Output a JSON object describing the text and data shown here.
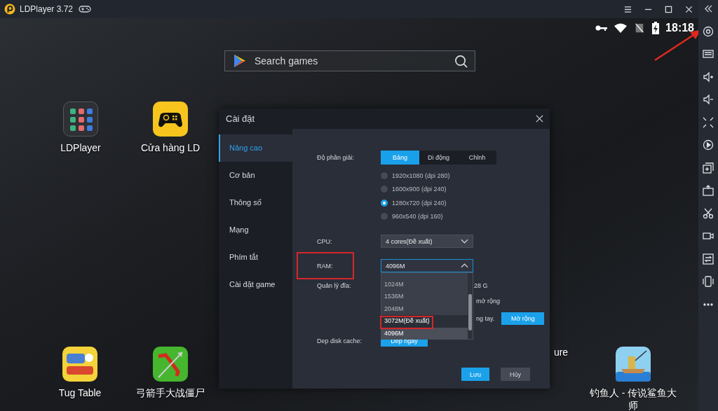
{
  "window": {
    "title": "LDPlayer 3.72"
  },
  "status_bar": {
    "time": "18:18"
  },
  "search": {
    "placeholder": "Search games"
  },
  "desktop_apps": [
    {
      "label": "LDPlayer",
      "kind": "folder"
    },
    {
      "label": "Cửa hàng LD",
      "kind": "store"
    },
    {
      "label": "Tug Table",
      "kind": "tug"
    },
    {
      "label": "弓箭手大战僵尸",
      "kind": "archer"
    },
    {
      "label": "ure",
      "kind": "partial"
    },
    {
      "label": "钓鱼人 - 传说鲨鱼大师",
      "kind": "fisher"
    }
  ],
  "dialog": {
    "title": "Cài đặt",
    "nav": [
      {
        "label": "Nâng cao",
        "selected": true
      },
      {
        "label": "Cơ bản",
        "selected": false
      },
      {
        "label": "Thông số",
        "selected": false
      },
      {
        "label": "Mạng",
        "selected": false
      },
      {
        "label": "Phím tắt",
        "selected": false
      },
      {
        "label": "Cài đặt game",
        "selected": false
      }
    ],
    "resolution": {
      "label": "Độ phân giải:",
      "tabs": [
        {
          "label": "Bảng",
          "selected": true
        },
        {
          "label": "Di động",
          "selected": false
        },
        {
          "label": "Chỉnh",
          "selected": false
        }
      ],
      "options": [
        {
          "label": "1920x1080  (dpi 280)",
          "selected": false
        },
        {
          "label": "1600x900  (dpi 240)",
          "selected": false
        },
        {
          "label": "1280x720  (dpi 240)",
          "selected": true
        },
        {
          "label": "960x540  (dpi 160)",
          "selected": false
        }
      ]
    },
    "cpu": {
      "label": "CPU:",
      "value": "4 cores(Đề xuất)"
    },
    "ram": {
      "label": "RAM:",
      "value": "4096M",
      "expanded": true,
      "options": [
        {
          "label": "1024M",
          "selected": false,
          "hovered": false
        },
        {
          "label": "1536M",
          "selected": false,
          "hovered": false
        },
        {
          "label": "2048M",
          "selected": false,
          "hovered": false
        },
        {
          "label": "3072M(Đề xuất)",
          "selected": false,
          "hovered": true
        },
        {
          "label": "4096M",
          "selected": true,
          "hovered": false
        }
      ]
    },
    "disk": {
      "label": "Quản lý đĩa:",
      "size": "28 G",
      "option_text": "mở rộng",
      "manual_text": "ng tay.",
      "button": "Mở rộng"
    },
    "cache": {
      "label": "Dep disk cache:",
      "button": "Dep ngay"
    },
    "buttons": [
      {
        "label": "Lưu",
        "kind": "primary"
      },
      {
        "label": "Hủy",
        "kind": "secondary"
      }
    ]
  }
}
